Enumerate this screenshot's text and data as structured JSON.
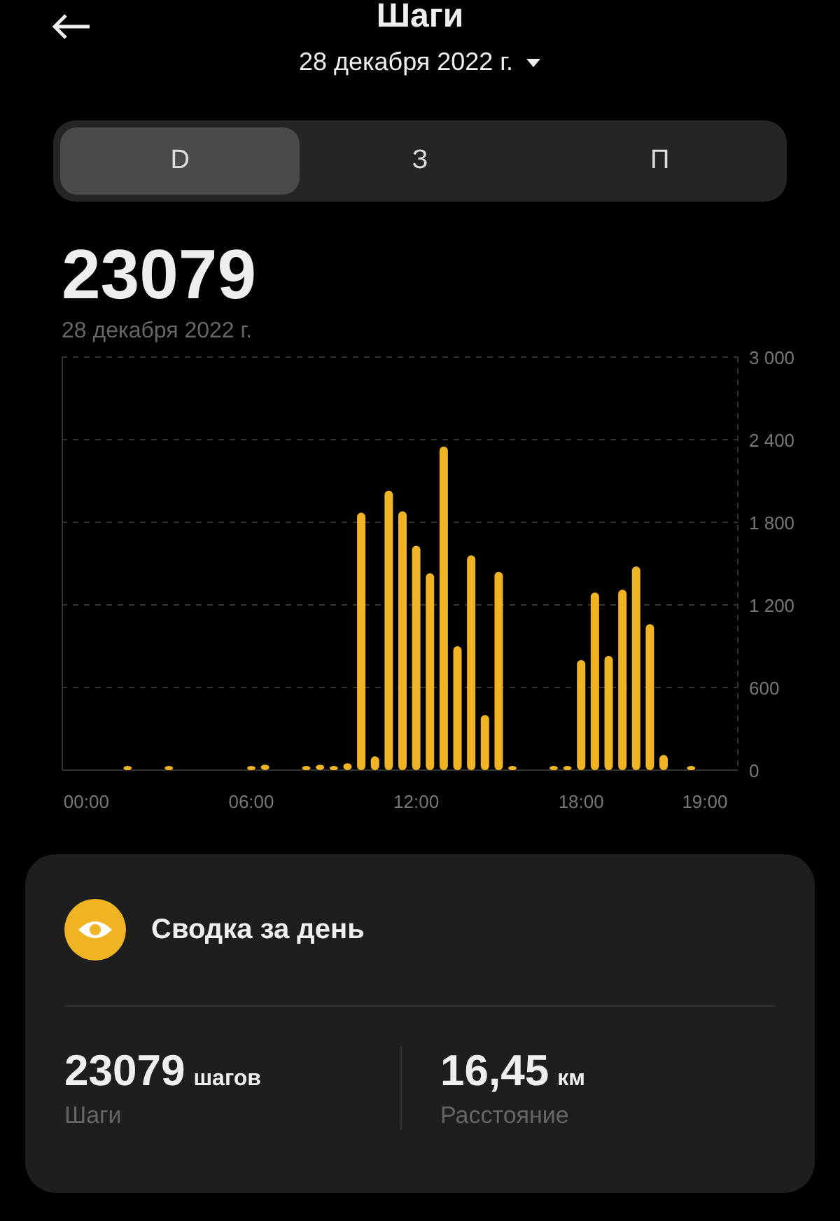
{
  "header": {
    "title": "Шаги",
    "date": "28 декабря 2022 г."
  },
  "tabs": [
    {
      "label": "D",
      "selected": true
    },
    {
      "label": "З",
      "selected": false
    },
    {
      "label": "П",
      "selected": false
    }
  ],
  "total": {
    "value": "23079",
    "date": "28 декабря 2022 г."
  },
  "chart_data": {
    "type": "bar",
    "categories": [
      "00:00",
      null,
      null,
      null,
      null,
      null,
      null,
      null,
      null,
      null,
      null,
      null,
      "06:00",
      null,
      null,
      null,
      null,
      null,
      null,
      null,
      null,
      null,
      null,
      null,
      "12:00",
      null,
      null,
      null,
      null,
      null,
      null,
      null,
      null,
      null,
      null,
      null,
      "18:00",
      null,
      null,
      null,
      null,
      null,
      null,
      null,
      null,
      "19:00",
      null
    ],
    "series": [
      {
        "color": "#f0b323",
        "values": [
          null,
          null,
          null,
          30,
          null,
          null,
          30,
          null,
          null,
          null,
          null,
          null,
          30,
          40,
          null,
          null,
          30,
          40,
          30,
          50,
          1870,
          100,
          2030,
          1880,
          1630,
          1430,
          2350,
          900,
          1560,
          400,
          1440,
          30,
          null,
          null,
          30,
          30,
          800,
          1290,
          830,
          1310,
          1480,
          1060,
          110,
          null,
          30,
          null,
          null
        ]
      }
    ],
    "ylim": [
      0,
      3000
    ],
    "grid": true,
    "yticks": [
      {
        "value": 0,
        "label": "0"
      },
      {
        "value": 600,
        "label": "600"
      },
      {
        "value": 1200,
        "label": "1 200"
      },
      {
        "value": 1800,
        "label": "1 800"
      },
      {
        "value": 2400,
        "label": "2 400"
      },
      {
        "value": 3000,
        "label": "3 000"
      }
    ]
  },
  "summary": {
    "title": "Сводка за день",
    "stats": [
      {
        "value": "23079",
        "unit": "шагов",
        "label": "Шаги"
      },
      {
        "value": "16,45",
        "unit": "км",
        "label": "Расстояние"
      }
    ]
  }
}
